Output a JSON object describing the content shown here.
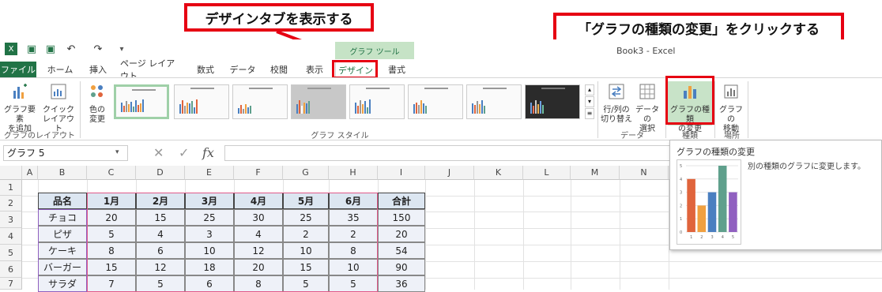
{
  "callouts": {
    "design_tab": "デザインタブを表示する",
    "change_type": "「グラフの種類の変更」をクリックする"
  },
  "titlebar": {
    "app_title": "Book3 - Excel",
    "context_tab_group": "グラフ ツール"
  },
  "tabs": [
    {
      "label": "ファイル"
    },
    {
      "label": "ホーム"
    },
    {
      "label": "挿入"
    },
    {
      "label": "ページ レイアウト"
    },
    {
      "label": "数式"
    },
    {
      "label": "データ"
    },
    {
      "label": "校閲"
    },
    {
      "label": "表示"
    },
    {
      "label": "デザイン"
    },
    {
      "label": "書式"
    }
  ],
  "ribbon": {
    "add_element": "グラフ要素\nを追加",
    "quick_layout": "クイック\nレイアウト",
    "change_color": "色の\n変更",
    "group_layout": "グラフのレイアウト",
    "group_style": "グラフ スタイル",
    "switch_rowcol": "行/列の\n切り替え",
    "select_data": "データの\n選択",
    "group_data": "データ",
    "change_type": "グラフの種類\nの変更",
    "group_type": "種類",
    "move_chart": "グラフの\n移動",
    "group_location": "場所"
  },
  "formula_bar": {
    "name_box": "グラフ 5",
    "fx": "fx"
  },
  "columns": [
    "A",
    "B",
    "C",
    "D",
    "E",
    "F",
    "G",
    "H",
    "I",
    "J",
    "K",
    "L",
    "M",
    "N"
  ],
  "rows": [
    "1",
    "2",
    "3",
    "4",
    "5",
    "6",
    "7"
  ],
  "table": {
    "headers": [
      "品名",
      "1月",
      "2月",
      "3月",
      "4月",
      "5月",
      "6月",
      "合計"
    ],
    "rows": [
      [
        "チョコ",
        "20",
        "15",
        "25",
        "30",
        "25",
        "35",
        "150"
      ],
      [
        "ピザ",
        "5",
        "4",
        "3",
        "4",
        "2",
        "2",
        "20"
      ],
      [
        "ケーキ",
        "8",
        "6",
        "10",
        "12",
        "10",
        "8",
        "54"
      ],
      [
        "バーガー",
        "15",
        "12",
        "18",
        "20",
        "15",
        "10",
        "90"
      ],
      [
        "サラダ",
        "7",
        "5",
        "6",
        "8",
        "5",
        "5",
        "36"
      ]
    ]
  },
  "tooltip": {
    "title": "グラフの種類の変更",
    "description": "別の種類のグラフに変更します。"
  },
  "tooltip_chart": {
    "type": "bar",
    "categories": [
      "1",
      "2",
      "3",
      "4",
      "5"
    ],
    "values": [
      4,
      2,
      3,
      5,
      3
    ],
    "ylim": [
      0,
      5
    ],
    "ticks": [
      "0",
      "1",
      "2",
      "3",
      "4",
      "5"
    ],
    "colors": [
      "#e0643c",
      "#f0a040",
      "#4a7fc0",
      "#5fa08c",
      "#9060c0"
    ]
  },
  "colors": {
    "accent": "#217346",
    "callout_red": "#e60012"
  }
}
